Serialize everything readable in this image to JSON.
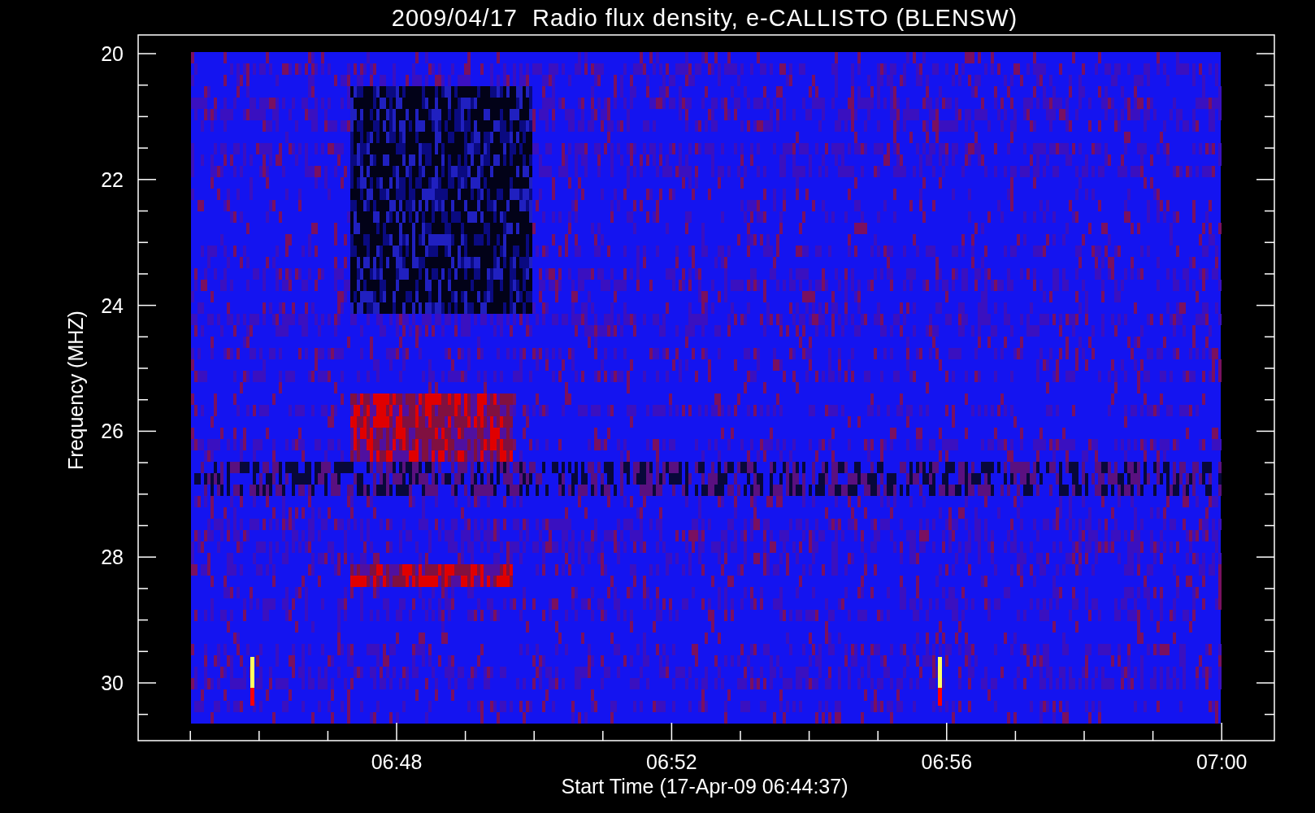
{
  "title": "2009/04/17  Radio flux density, e-CALLISTO (BLENSW)",
  "plot": {
    "ylabel": "Frequency (MHZ)",
    "xlabel": "Start Time (17-Apr-09 06:44:37)",
    "yticks": [
      "20",
      "22",
      "24",
      "26",
      "28",
      "30"
    ],
    "xticks": [
      "06:48",
      "06:52",
      "06:56",
      "07:00"
    ]
  }
}
